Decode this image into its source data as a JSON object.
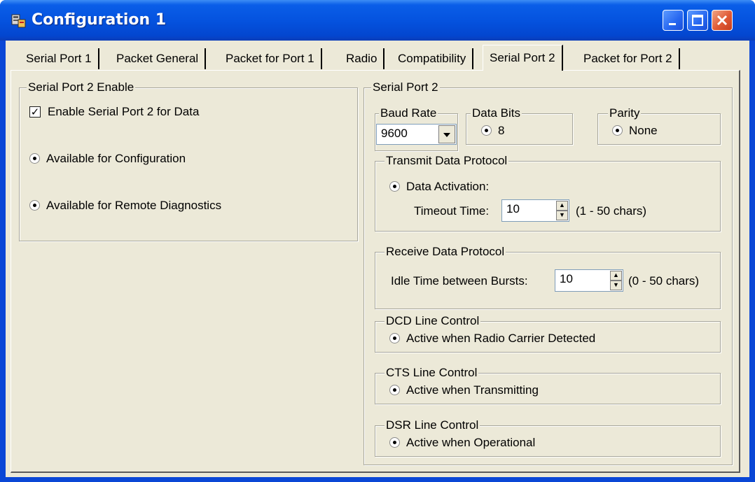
{
  "window": {
    "title": "Configuration 1",
    "app_icon": "config-app-icon"
  },
  "tabs": [
    {
      "label": "Serial Port 1"
    },
    {
      "label": "Packet General"
    },
    {
      "label": "Packet for Port 1"
    },
    {
      "label": "Radio"
    },
    {
      "label": "Compatibility"
    },
    {
      "label": "Serial Port 2",
      "active": true
    },
    {
      "label": "Packet for Port 2"
    }
  ],
  "enable_group": {
    "title": "Serial Port 2 Enable",
    "enable_checkbox": {
      "label": "Enable Serial Port 2 for Data",
      "checked": true
    },
    "config_radio": {
      "label": "Available for Configuration",
      "selected": true
    },
    "diag_radio": {
      "label": "Available for Remote Diagnostics",
      "selected": true
    }
  },
  "serial_group": {
    "title": "Serial Port 2",
    "baud": {
      "title": "Baud Rate",
      "value": "9600"
    },
    "databits": {
      "title": "Data Bits",
      "option": "8"
    },
    "parity": {
      "title": "Parity",
      "option": "None"
    },
    "transmit": {
      "title": "Transmit Data Protocol",
      "radio": "Data Activation:",
      "timeout_label": "Timeout Time:",
      "timeout_value": "10",
      "range": "(1 - 50 chars)"
    },
    "receive": {
      "title": "Receive Data Protocol",
      "idle_label": "Idle Time between Bursts:",
      "idle_value": "10",
      "range": "(0 - 50 chars)"
    },
    "dcd": {
      "title": "DCD Line Control",
      "option": "Active when Radio Carrier Detected"
    },
    "cts": {
      "title": "CTS Line Control",
      "option": "Active when Transmitting"
    },
    "dsr": {
      "title": "DSR Line Control",
      "option": "Active when Operational"
    }
  },
  "colors": {
    "titlebar": "#0553df",
    "face": "#ece9d8",
    "close": "#e05a35"
  }
}
